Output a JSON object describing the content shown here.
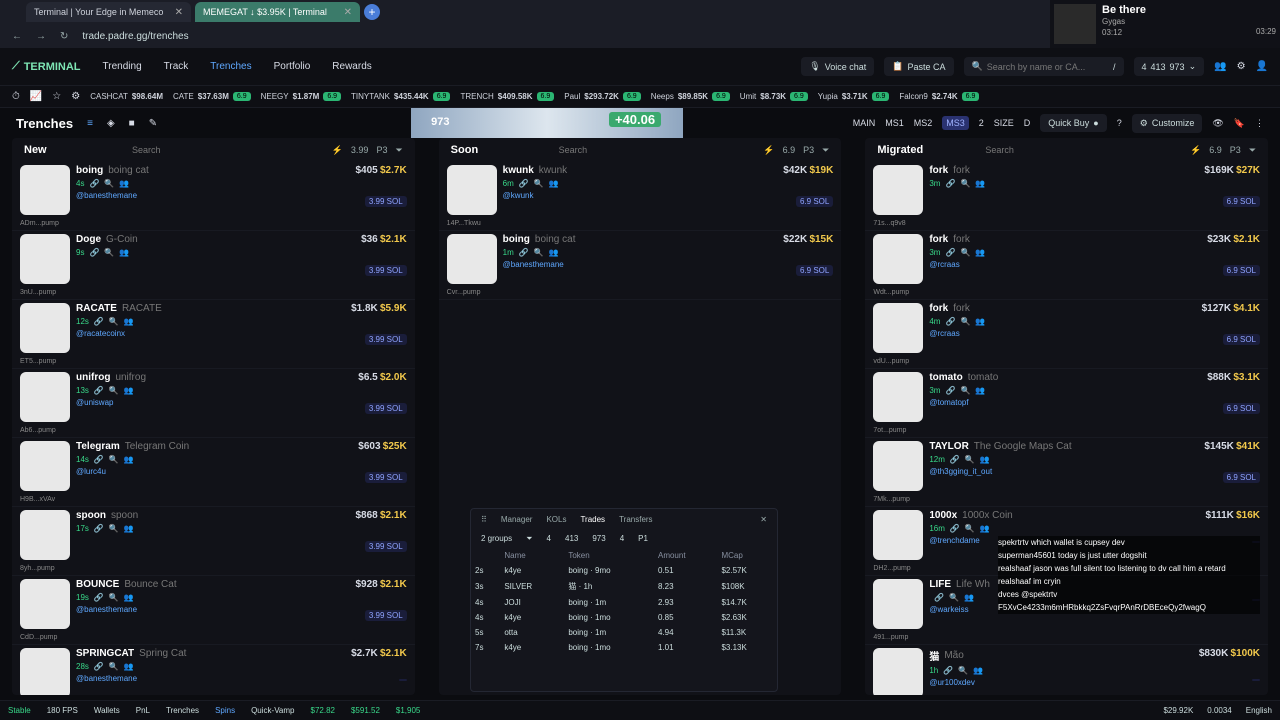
{
  "browser": {
    "tabs": [
      {
        "title": "Terminal | Your Edge in Memeco"
      },
      {
        "title": "MEMEGAT ↓ $3.95K | Terminal"
      }
    ],
    "url": "trade.padre.gg/trenches"
  },
  "media": {
    "title": "Be there",
    "artist": "Gygas",
    "elapsed": "03:12",
    "total": "03:29"
  },
  "nav": {
    "logo": "TERMINAL",
    "items": [
      "Trending",
      "Track",
      "Trenches",
      "Portfolio",
      "Rewards"
    ],
    "voice": "Voice chat",
    "paste": "Paste CA",
    "search_placeholder": "Search by name or CA...",
    "slash": "/",
    "wallets": "4",
    "sol": "413",
    "usd": "973"
  },
  "ticker": [
    {
      "n": "CASHCAT",
      "v": "$98.64M"
    },
    {
      "n": "CATE",
      "v": "$37.63M",
      "c": "6.9"
    },
    {
      "n": "NEEGY",
      "v": "$1.87M",
      "c": "6.9"
    },
    {
      "n": "TINYTANK",
      "v": "$435.44K",
      "c": "6.9"
    },
    {
      "n": "TRENCH",
      "v": "$409.58K",
      "c": "6.9"
    },
    {
      "n": "Paul",
      "v": "$293.72K",
      "c": "6.9"
    },
    {
      "n": "Neeps",
      "v": "$89.85K",
      "c": "6.9"
    },
    {
      "n": "Umit",
      "v": "$8.73K",
      "c": "6.9"
    },
    {
      "n": "Yupia",
      "v": "$3.71K",
      "c": "6.9"
    },
    {
      "n": "Falcon9",
      "v": "$2.74K",
      "c": "6.9"
    }
  ],
  "sub": {
    "title": "Trenches",
    "banner_left": "973",
    "banner_right": "+40.06",
    "main": "MAIN",
    "ms1": "MS1",
    "ms2": "MS2",
    "ms3": "MS3",
    "two": "2",
    "size": "SIZE",
    "d": "D",
    "quick": "Quick Buy",
    "customize": "Customize"
  },
  "columns": [
    {
      "title": "New",
      "search": "Search",
      "val": "3.99",
      "p": "P3",
      "cards": [
        {
          "name": "boing",
          "sub": "boing cat",
          "age": "4s",
          "addr": "ADm...pump",
          "mc": "$2.7K",
          "v": "$405",
          "sol": "3.99 SOL",
          "dev": "@banesthemane"
        },
        {
          "name": "Doge",
          "sub": "G-Coin",
          "age": "9s",
          "addr": "3nU...pump",
          "mc": "$2.1K",
          "v": "$36",
          "sol": "3.99 SOL",
          "dev": ""
        },
        {
          "name": "RACATE",
          "sub": "RACATE",
          "age": "12s",
          "addr": "ET5...pump",
          "mc": "$5.9K",
          "v": "$1.8K",
          "sol": "3.99 SOL",
          "dev": "@racatecoinx"
        },
        {
          "name": "unifrog",
          "sub": "unifrog",
          "age": "13s",
          "addr": "Ab6...pump",
          "mc": "$2.0K",
          "v": "$6.5",
          "sol": "3.99 SOL",
          "dev": "@uniswap"
        },
        {
          "name": "Telegram",
          "sub": "Telegram Coin",
          "age": "14s",
          "addr": "H9B...xVAv",
          "mc": "$25K",
          "v": "$603",
          "sol": "3.99 SOL",
          "dev": "@lurc4u"
        },
        {
          "name": "spoon",
          "sub": "spoon",
          "age": "17s",
          "addr": "8yh...pump",
          "mc": "$2.1K",
          "v": "$868",
          "sol": "3.99 SOL",
          "dev": ""
        },
        {
          "name": "BOUNCE",
          "sub": "Bounce Cat",
          "age": "19s",
          "addr": "CdD...pump",
          "mc": "$2.1K",
          "v": "$928",
          "sol": "3.99 SOL",
          "dev": "@banesthemane"
        },
        {
          "name": "SPRINGCAT",
          "sub": "Spring Cat",
          "age": "28s",
          "addr": "",
          "mc": "$2.1K",
          "v": "$2.7K",
          "sol": "",
          "dev": "@banesthemane"
        }
      ]
    },
    {
      "title": "Soon",
      "search": "Search",
      "val": "6.9",
      "p": "P3",
      "cards": [
        {
          "name": "kwunk",
          "sub": "kwunk",
          "age": "6m",
          "addr": "14P...Tkwu",
          "mc": "$19K",
          "v": "$42K",
          "sol": "6.9 SOL",
          "dev": "@kwunk"
        },
        {
          "name": "boing",
          "sub": "boing cat",
          "age": "1m",
          "addr": "Cvr...pump",
          "mc": "$15K",
          "v": "$22K",
          "sol": "6.9 SOL",
          "dev": "@banesthemane"
        }
      ]
    },
    {
      "title": "Migrated",
      "search": "Search",
      "val": "6.9",
      "p": "P3",
      "cards": [
        {
          "name": "fork",
          "sub": "fork",
          "age": "3m",
          "addr": "71s...q9v8",
          "mc": "$27K",
          "v": "$169K",
          "sol": "6.9 SOL",
          "dev": ""
        },
        {
          "name": "fork",
          "sub": "fork",
          "age": "3m",
          "addr": "Wdt...pump",
          "mc": "$2.1K",
          "v": "$23K",
          "sol": "6.9 SOL",
          "dev": "@rcraas"
        },
        {
          "name": "fork",
          "sub": "fork",
          "age": "4m",
          "addr": "vdU...pump",
          "mc": "$4.1K",
          "v": "$127K",
          "sol": "6.9 SOL",
          "dev": "@rcraas"
        },
        {
          "name": "tomato",
          "sub": "tomato",
          "age": "3m",
          "addr": "7ot...pump",
          "mc": "$3.1K",
          "v": "$88K",
          "sol": "6.9 SOL",
          "dev": "@tomatopf"
        },
        {
          "name": "TAYLOR",
          "sub": "The Google Maps Cat",
          "age": "12m",
          "addr": "7Mk...pump",
          "mc": "$41K",
          "v": "$145K",
          "sol": "6.9 SOL",
          "dev": "@th3gging_it_out"
        },
        {
          "name": "1000x",
          "sub": "1000x Coin",
          "age": "16m",
          "addr": "DH2...pump",
          "mc": "$16K",
          "v": "$111K",
          "sol": "",
          "dev": "@trenchdame"
        },
        {
          "name": "LIFE",
          "sub": "Life Wh",
          "age": "",
          "addr": "491...pump",
          "mc": "",
          "v": "",
          "sol": "",
          "dev": "@warkeiss"
        },
        {
          "name": "猫",
          "sub": "Mão",
          "age": "1h",
          "addr": "",
          "mc": "$100K",
          "v": "$830K",
          "sol": "",
          "dev": "@ur100xdev"
        }
      ]
    }
  ],
  "trades": {
    "tabs": [
      "Manager",
      "KOLs",
      "Trades",
      "Transfers"
    ],
    "groups": "2 groups",
    "f1": "4",
    "f2": "413",
    "f3": "973",
    "f4": "4",
    "p": "P1",
    "headers": [
      "Name",
      "Token",
      "Amount",
      "MCap"
    ],
    "rows": [
      [
        "2s",
        "k4ye",
        "boing · 9mo",
        "0.51",
        "$2.57K"
      ],
      [
        "3s",
        "SILVER",
        "猫 · 1h",
        "8.23",
        "$108K"
      ],
      [
        "4s",
        "JOJI",
        "boing · 1m",
        "2.93",
        "$14.7K"
      ],
      [
        "4s",
        "k4ye",
        "boing · 1mo",
        "0.85",
        "$2.63K"
      ],
      [
        "5s",
        "otta",
        "boing · 1m",
        "4.94",
        "$11.3K"
      ],
      [
        "7s",
        "k4ye",
        "boing · 1mo",
        "1.01",
        "$3.13K"
      ]
    ]
  },
  "chat": [
    "spekrtrtv which wallet is cupsey dev",
    "superman45601 today is just utter dogshit",
    "realshaaf jason was full silent too listening to dv call him a retard",
    "realshaaf im cryin",
    "dvces @spektrtv",
    "F5XvCe4233m6mHRbkkq2ZsFvqrPAnRrDBEceQy2fwagQ"
  ],
  "footer": {
    "stable": "Stable",
    "fps": "180 FPS",
    "wallets": "Wallets",
    "pnl": "PnL",
    "trenches": "Trenches",
    "spins": "Spins",
    "vamp": "Quick-Vamp",
    "p1": "$72.82",
    "p2": "$591.52",
    "p3": "$1,905",
    "r1": "$29.92K",
    "r2": "0.0034",
    "lang": "English"
  }
}
